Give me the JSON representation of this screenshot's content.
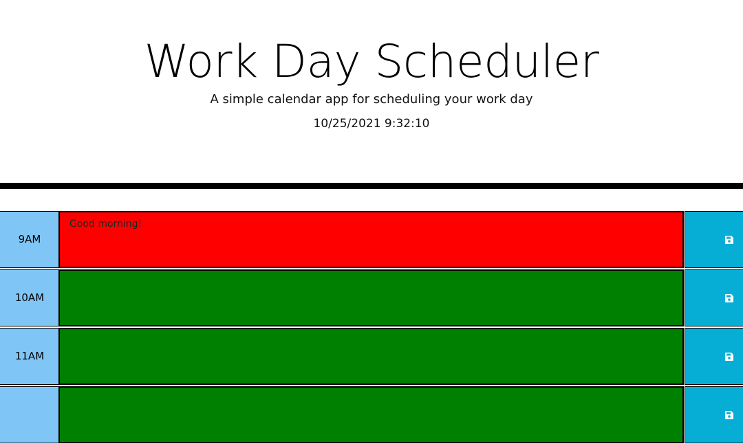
{
  "header": {
    "title": "Work Day Scheduler",
    "subtitle": "A simple calendar app for scheduling your work day",
    "datetime": "10/25/2021 9:32:10"
  },
  "colors": {
    "past": "#d3d3d3",
    "present": "#ff0000",
    "future": "#008000",
    "hour_bg": "#7fc6f7",
    "save_bg": "#06aed5"
  },
  "time_blocks": [
    {
      "hour": "9AM",
      "status": "present",
      "text": "Good morning!",
      "save_icon": "floppy-disk-icon"
    },
    {
      "hour": "10AM",
      "status": "future",
      "text": "",
      "save_icon": "floppy-disk-icon"
    },
    {
      "hour": "11AM",
      "status": "future",
      "text": "",
      "save_icon": "floppy-disk-icon"
    },
    {
      "hour": "",
      "status": "future",
      "text": "",
      "save_icon": "floppy-disk-icon"
    }
  ]
}
